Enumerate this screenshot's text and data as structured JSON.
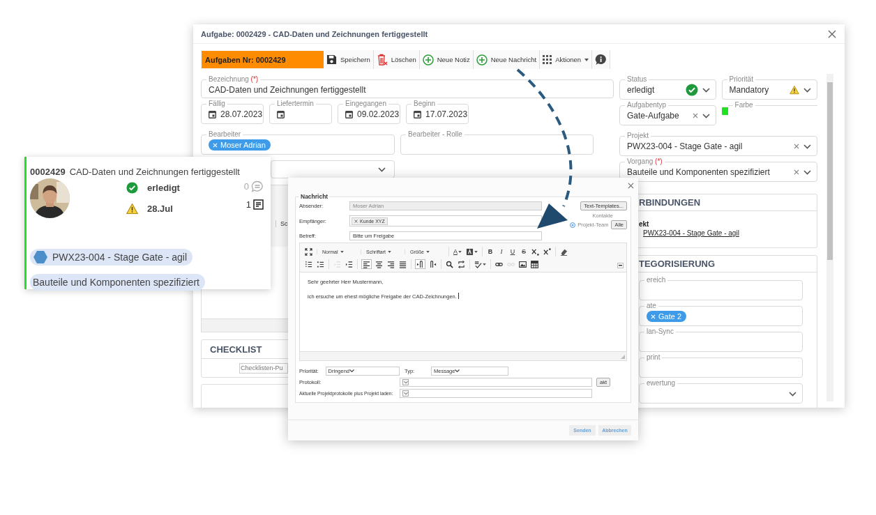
{
  "task_window": {
    "title": "Aufgabe: 0002429 - CAD-Daten und Zeichnungen fertiggestellt",
    "toolbar": {
      "task_number": "Aufgaben Nr: 0002429",
      "buttons": [
        {
          "kind": "save",
          "label": "Speichern"
        },
        {
          "kind": "delete",
          "label": "Löschen"
        },
        {
          "kind": "add",
          "label": "Neue Notiz"
        },
        {
          "kind": "add",
          "label": "Neue Nachricht"
        },
        {
          "kind": "menu",
          "label": "Aktionen"
        },
        {
          "kind": "info"
        }
      ]
    },
    "bezeichnung": {
      "label": "Bezeichnung",
      "required": "(*)",
      "value": "CAD-Daten und Zeichnungen fertiggestellt"
    },
    "dates": [
      {
        "label": "Fällig",
        "value": "28.07.2023"
      },
      {
        "label": "Liefertermin"
      },
      {
        "label": "Eingegangen",
        "value": "09.02.2023"
      },
      {
        "label": "Beginn",
        "value": "17.07.2023"
      }
    ],
    "bearbeiter": {
      "label": "Bearbeiter",
      "chips": [
        "Moser Adrian"
      ]
    },
    "bearbeiter_rolle": {
      "label": "Bearbeiter - Rolle"
    },
    "editor_fragment": {
      "text": "Sc"
    },
    "checklist": {
      "title": "CHECKLIST",
      "placeholder": "Checklisten-Pu"
    },
    "status": {
      "label": "Status",
      "value": "erledigt"
    },
    "prioritaet": {
      "label": "Priorität",
      "value": "Mandatory"
    },
    "aufgabentyp": {
      "label": "Aufgabentyp",
      "value": "Gate-Aufgabe"
    },
    "farbe": {
      "label": "Farbe",
      "color": "#22e022"
    },
    "projekt": {
      "label": "Projekt",
      "value": "PWX23-004 - Stage Gate - agil"
    },
    "vorgang": {
      "label": "Vorgang",
      "required": "(*)",
      "value": "Bauteile und Komponenten spezifiziert"
    },
    "verbindungen": {
      "title": "RBINDUNGEN",
      "label": "ekt",
      "link": "PWX23-004 - Stage Gate - agil"
    },
    "kategorisierung": {
      "title": "TEGORISIERUNG",
      "fields": [
        {
          "label": "ereich",
          "kind": "text"
        },
        {
          "label": "ate",
          "kind": "chips",
          "chips": [
            "Gate 2"
          ]
        },
        {
          "label": "lan-Sync",
          "kind": "text"
        },
        {
          "label": "print",
          "kind": "text"
        },
        {
          "label": "ewertung",
          "kind": "select"
        }
      ]
    }
  },
  "task_card": {
    "number": "0002429",
    "title": "CAD-Daten und Zeichnungen fertiggestellt",
    "status": "erledigt",
    "due": "28.Jul",
    "comments": "0",
    "notes": "1",
    "color": "#22e022",
    "tags": [
      {
        "kind": "project",
        "label": "PWX23-004 - Stage Gate - agil"
      },
      {
        "kind": "plain",
        "label": "Bauteile und Komponenten spezifiziert"
      }
    ]
  },
  "message_dialog": {
    "legend": "Nachricht",
    "absender": {
      "label": "Absender:",
      "value": "Moser Adrian"
    },
    "templates_button": "Text-Templates...",
    "empfaenger": {
      "label": "Empfänger:",
      "chips": [
        "Kunde XYZ"
      ]
    },
    "contacts_label": "Kontakte",
    "team_option": {
      "label": "Projekt-Team",
      "selected": true
    },
    "all_button": "Alle",
    "betreff": {
      "label": "Betreff:",
      "value": "Bitte um Freigabe"
    },
    "editor": {
      "toolbar_rows": [
        [
          [
            {
              "kind": "icon"
            }
          ],
          [
            {
              "kind": "select",
              "label": "Normal"
            }
          ],
          [
            {
              "kind": "select",
              "label": "Schriftart"
            }
          ],
          [
            {
              "kind": "select",
              "label": "Größe"
            }
          ],
          [
            {
              "kind": "glyph",
              "label": "A",
              "dropdown": true
            },
            {
              "kind": "icon",
              "dropdown": true
            }
          ],
          [
            {
              "kind": "glyph",
              "label": "B"
            },
            {
              "kind": "glyph",
              "label": "I"
            },
            {
              "kind": "glyph",
              "label": "U"
            },
            {
              "kind": "glyph",
              "label": "S"
            },
            {
              "kind": "icon"
            },
            {
              "kind": "icon"
            }
          ],
          [
            {
              "kind": "icon"
            }
          ]
        ],
        [
          [
            {
              "kind": "icon",
              "active": false,
              "disabled": false
            },
            {
              "kind": "icon",
              "active": false,
              "disabled": false
            }
          ],
          [
            {
              "kind": "icon",
              "active": false,
              "disabled": true
            },
            {
              "kind": "icon",
              "active": false,
              "disabled": false
            }
          ],
          [
            {
              "kind": "icon",
              "active": true,
              "disabled": false
            },
            {
              "kind": "icon",
              "active": false,
              "disabled": false
            },
            {
              "kind": "icon",
              "active": false,
              "disabled": false
            },
            {
              "kind": "icon",
              "active": false,
              "disabled": false
            }
          ],
          [
            {
              "kind": "icon",
              "active": true,
              "disabled": false
            },
            {
              "kind": "icon",
              "active": false,
              "disabled": false
            }
          ],
          [
            {
              "kind": "icon",
              "active": false,
              "disabled": false
            },
            {
              "kind": "icon",
              "active": false,
              "disabled": false
            }
          ],
          [
            {
              "kind": "icon",
              "active": false,
              "disabled": false,
              "dropdown": true
            }
          ],
          [
            {
              "kind": "icon",
              "active": false,
              "disabled": false
            },
            {
              "kind": "icon",
              "active": false,
              "disabled": true
            },
            {
              "kind": "icon",
              "active": false,
              "disabled": false
            },
            {
              "kind": "icon",
              "active": false,
              "disabled": false
            }
          ]
        ]
      ],
      "body": [
        "Sehr geehrter Herr Mustermann,",
        "ich ersuche um ehest mögliche Freigabe der CAD-Zeichnungen."
      ]
    },
    "prioritaet": {
      "label": "Priorität:",
      "value": "Dringend"
    },
    "typ": {
      "label": "Typ:",
      "value": "Message"
    },
    "protokoll": {
      "label": "Protokoll:"
    },
    "akt_button": "akt",
    "projektprotokolle": {
      "label": "Aktuelle Projektprotokolle plus Projekt laden:"
    },
    "buttons": [
      "Senden",
      "Abbrechen"
    ]
  }
}
